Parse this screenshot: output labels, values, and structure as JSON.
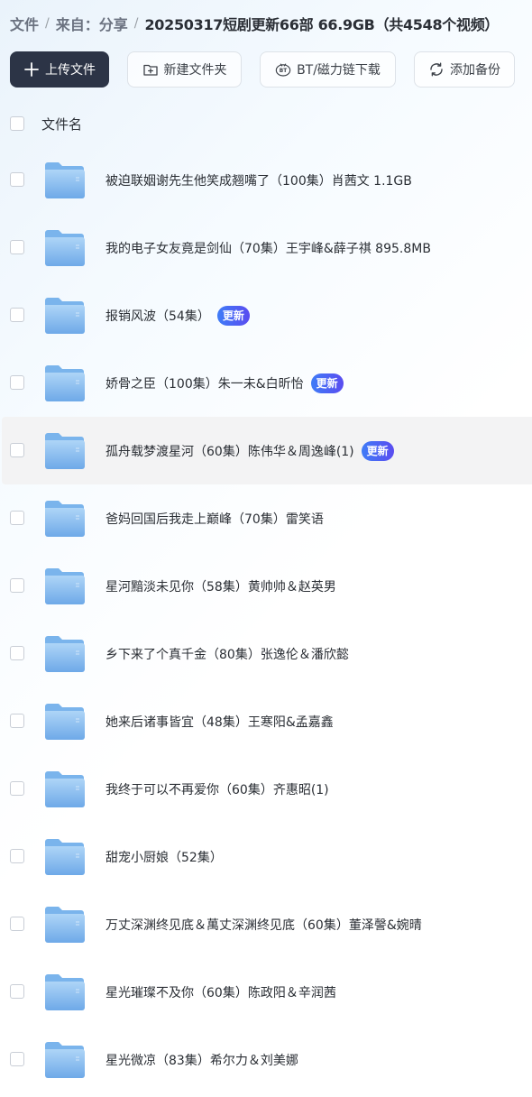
{
  "breadcrumb": {
    "items": [
      "文件",
      "来自：分享"
    ],
    "current": "20250317短剧更新66部 66.9GB（共4548个视频）",
    "separator": "/"
  },
  "toolbar": {
    "upload_label": "上传文件",
    "new_folder_label": "新建文件夹",
    "bt_label": "BT/磁力链下载",
    "backup_label": "添加备份"
  },
  "list_header": {
    "name_label": "文件名"
  },
  "files": [
    {
      "name": "被迫联姻谢先生他笑成翘嘴了（100集）肖茜文 1.1GB",
      "badge": ""
    },
    {
      "name": "我的电子女友竟是剑仙（70集）王宇峰&薛子祺 895.8MB",
      "badge": ""
    },
    {
      "name": "报销风波（54集）",
      "badge": "更新"
    },
    {
      "name": "娇骨之臣（100集）朱一未&白昕怡",
      "badge": "更新"
    },
    {
      "name": "孤舟载梦渡星河（60集）陈伟华＆周逸峰(1)",
      "badge": "更新",
      "selected": true
    },
    {
      "name": "爸妈回国后我走上巅峰（70集）雷笑语",
      "badge": ""
    },
    {
      "name": "星河黯淡未见你（58集）黄帅帅＆赵英男",
      "badge": ""
    },
    {
      "name": "乡下来了个真千金（80集）张逸伦＆潘欣懿",
      "badge": ""
    },
    {
      "name": "她来后诸事皆宜（48集）王寒阳&孟嘉鑫",
      "badge": ""
    },
    {
      "name": "我终于可以不再爱你（60集）齐惠昭(1)",
      "badge": ""
    },
    {
      "name": "甜宠小厨娘（52集）",
      "badge": ""
    },
    {
      "name": "万丈深渊终见底＆萬丈深渊终见底（60集）董泽謦&婉晴",
      "badge": ""
    },
    {
      "name": "星光璀璨不及你（60集）陈政阳＆辛润茜",
      "badge": ""
    },
    {
      "name": "星光微凉（83集）希尔力＆刘美娜",
      "badge": ""
    }
  ],
  "colors": {
    "primary_button": "#2c3446",
    "badge_start": "#3f7cf7",
    "badge_end": "#5a4cf0",
    "folder_top": "#aed5f7",
    "folder_bottom": "#6ea9e8"
  },
  "icons": {
    "upload": "plus-icon",
    "new_folder": "folder-plus-icon",
    "bt": "bt-icon",
    "backup": "sync-icon",
    "folder": "folder-icon"
  }
}
